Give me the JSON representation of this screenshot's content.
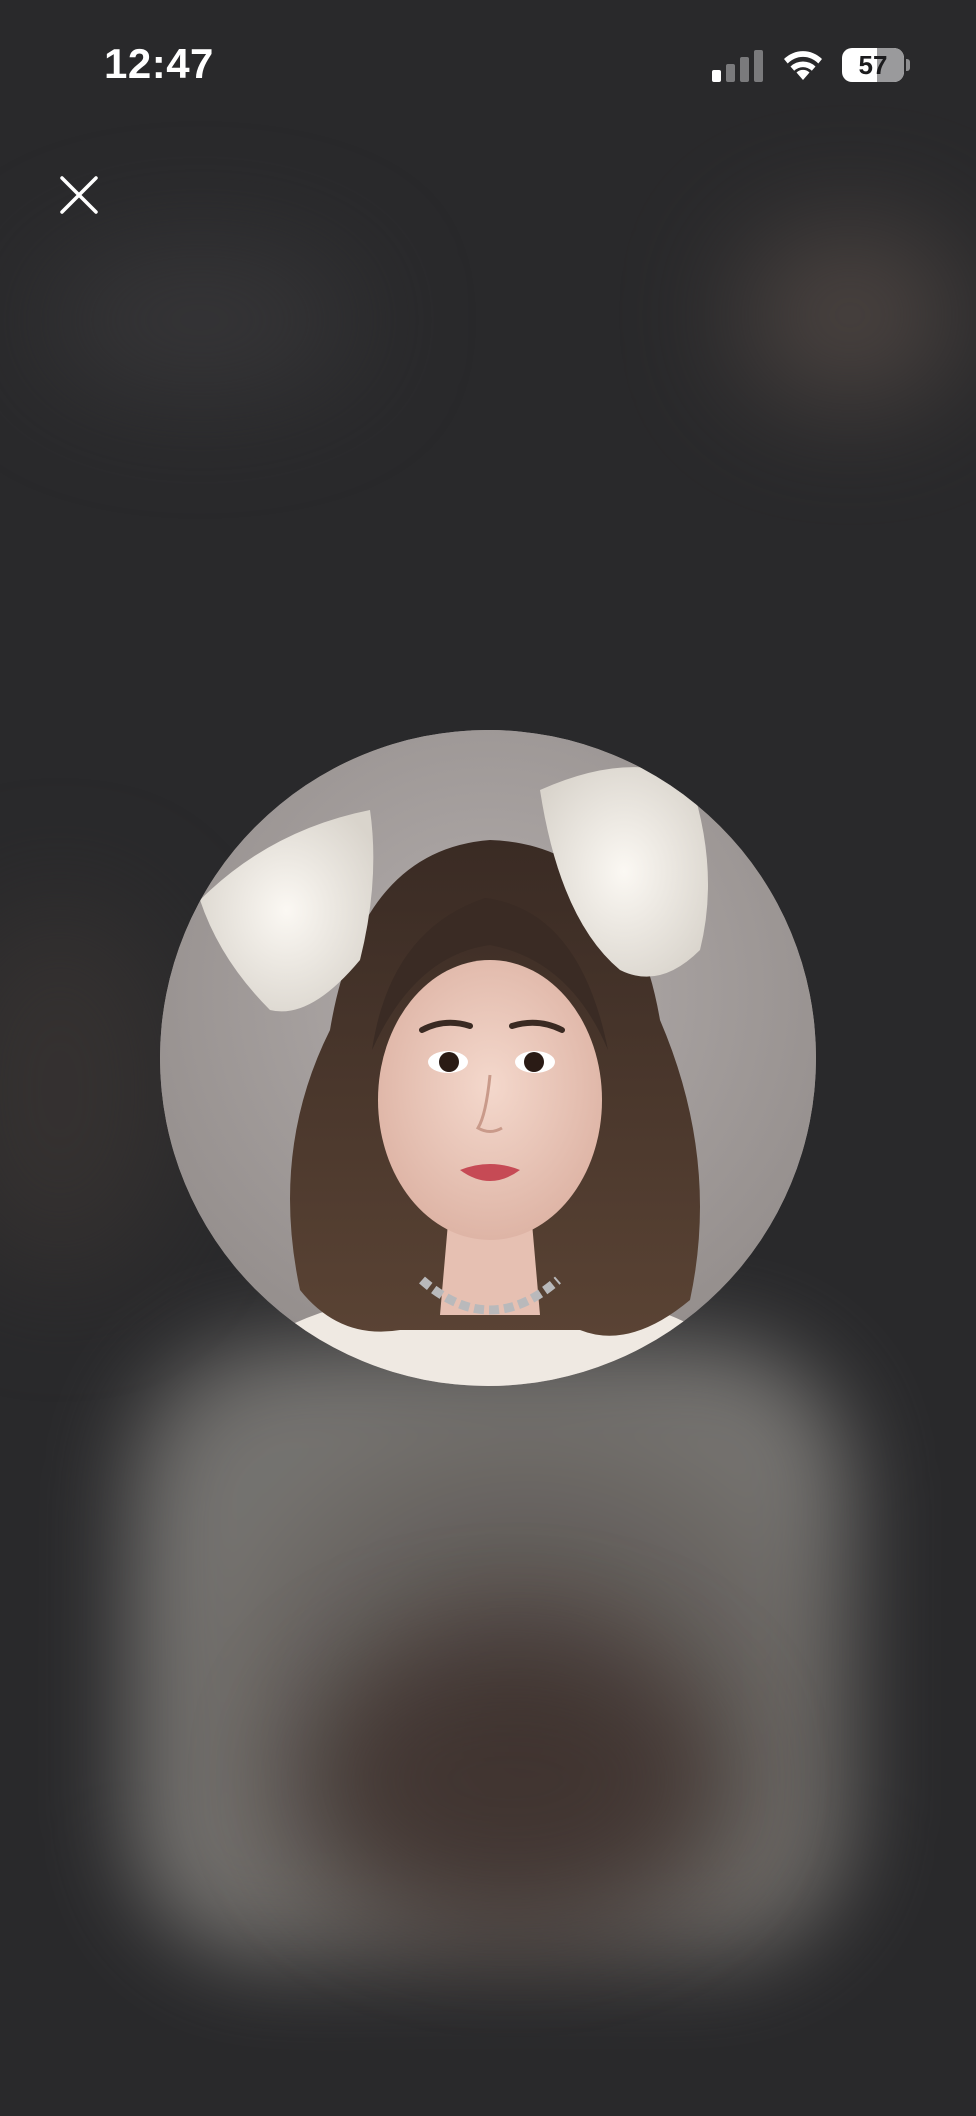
{
  "status_bar": {
    "time": "12:47",
    "battery_level": "57",
    "battery_fraction": 0.57,
    "signal_bars_active": 1,
    "signal_bars_total": 4,
    "icons": [
      "cellular-signal-icon",
      "wifi-icon",
      "battery-icon"
    ]
  },
  "controls": {
    "close_icon": "close-icon"
  },
  "profile_photo": {
    "shape": "circle",
    "subject": "portrait-photo"
  },
  "colors": {
    "background": "#29292b",
    "status_text": "#ffffff"
  }
}
